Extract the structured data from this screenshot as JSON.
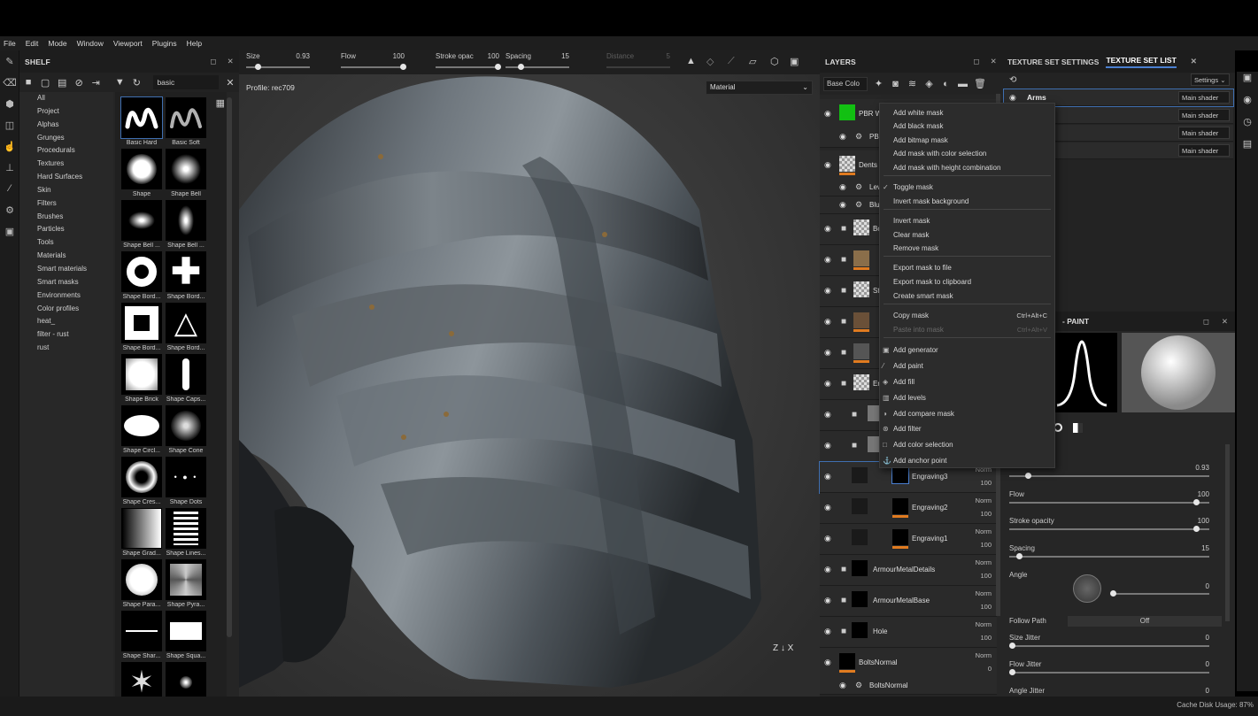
{
  "menu": [
    "File",
    "Edit",
    "Mode",
    "Window",
    "Viewport",
    "Plugins",
    "Help"
  ],
  "shelf": {
    "title": "SHELF",
    "search_value": "basic",
    "categories": [
      "All",
      "Project",
      "Alphas",
      "Grunges",
      "Procedurals",
      "Textures",
      "Hard Surfaces",
      "Skin",
      "Filters",
      "Brushes",
      "Particles",
      "Tools",
      "Materials",
      "Smart materials",
      "Smart masks",
      "Environments",
      "Color profiles",
      "heat_",
      "filter - rust",
      "rust"
    ],
    "items": [
      "Basic Hard",
      "Basic Soft",
      "Shape",
      "Shape Bell",
      "Shape Bell ...",
      "Shape Bell ...",
      "Shape Bord...",
      "Shape Bord...",
      "Shape Bord...",
      "Shape Bord...",
      "Shape Brick",
      "Shape Caps...",
      "Shape Circl...",
      "Shape Cone",
      "Shape Cres...",
      "Shape Dots",
      "Shape Grad...",
      "Shape Lines...",
      "Shape Para...",
      "Shape Pyra...",
      "Shape Shar...",
      "Shape Squa...",
      "",
      ""
    ]
  },
  "viewport": {
    "toolbar": {
      "size_label": "Size",
      "size_value": "0.93",
      "flow_label": "Flow",
      "flow_value": "100",
      "stroke_label": "Stroke opac",
      "stroke_value": "100",
      "spacing_label": "Spacing",
      "spacing_value": "15",
      "distance_label": "Distance",
      "distance_value": "5"
    },
    "profile": "Profile: rec709",
    "material_mode": "Material"
  },
  "layers": {
    "title": "LAYERS",
    "channel": "Base Colo",
    "rows": [
      {
        "name": "PBR W",
        "blend": "",
        "opacity": ""
      },
      {
        "name": "PBR",
        "blend": "",
        "opacity": ""
      },
      {
        "name": "Dents",
        "blend": "",
        "opacity": ""
      },
      {
        "name": "Lev",
        "blend": "",
        "opacity": ""
      },
      {
        "name": "Blu",
        "blend": "",
        "opacity": ""
      },
      {
        "name": "Bo",
        "blend": "",
        "opacity": ""
      },
      {
        "name": "",
        "blend": "",
        "opacity": ""
      },
      {
        "name": "St",
        "blend": "",
        "opacity": ""
      },
      {
        "name": "",
        "blend": "",
        "opacity": ""
      },
      {
        "name": "",
        "blend": "",
        "opacity": ""
      },
      {
        "name": "En",
        "blend": "",
        "opacity": ""
      },
      {
        "name": "",
        "blend": "",
        "opacity": ""
      },
      {
        "name": "",
        "blend": "",
        "opacity": ""
      },
      {
        "name": "Engraving3",
        "blend": "Norm",
        "opacity": "100"
      },
      {
        "name": "Engraving2",
        "blend": "Norm",
        "opacity": "100"
      },
      {
        "name": "Engraving1",
        "blend": "Norm",
        "opacity": "100"
      },
      {
        "name": "ArmourMetalDetails",
        "blend": "Norm",
        "opacity": "100"
      },
      {
        "name": "ArmourMetalBase",
        "blend": "Norm",
        "opacity": "100"
      },
      {
        "name": "Hole",
        "blend": "Norm",
        "opacity": "100"
      },
      {
        "name": "BoltsNormal",
        "blend": "Norm",
        "opacity": "0"
      },
      {
        "name": "BoltsNormal",
        "blend": "",
        "opacity": ""
      }
    ]
  },
  "texture_sets": {
    "tab_settings": "TEXTURE SET SETTINGS",
    "tab_list": "TEXTURE SET LIST",
    "settings_btn": "Settings",
    "rows": [
      {
        "name": "Arms",
        "shader": "Main shader"
      },
      {
        "name": "",
        "shader": "Main shader"
      },
      {
        "name": "",
        "shader": "Main shader"
      },
      {
        "name": "",
        "shader": "Main shader"
      }
    ]
  },
  "properties": {
    "title": "- PAINT",
    "size_value": "0.93",
    "flow_label": "Flow",
    "flow_value": "100",
    "stroke_label": "Stroke opacity",
    "stroke_value": "100",
    "spacing_label": "Spacing",
    "spacing_value": "15",
    "angle_label": "Angle",
    "angle_value": "0",
    "follow_path_label": "Follow Path",
    "follow_path_value": "Off",
    "size_jitter_label": "Size Jitter",
    "size_jitter_value": "0",
    "flow_jitter_label": "Flow Jitter",
    "flow_jitter_value": "0",
    "angle_jitter_label": "Angle Jitter",
    "angle_jitter_value": "0"
  },
  "context_menu": {
    "items": [
      {
        "label": "Add white mask",
        "shortcut": "",
        "disabled": false,
        "icon": ""
      },
      {
        "label": "Add black mask",
        "shortcut": "",
        "disabled": false,
        "icon": ""
      },
      {
        "label": "Add bitmap mask",
        "shortcut": "",
        "disabled": false,
        "icon": ""
      },
      {
        "label": "Add mask with color selection",
        "shortcut": "",
        "disabled": false,
        "icon": ""
      },
      {
        "label": "Add mask with height combination",
        "shortcut": "",
        "disabled": false,
        "icon": ""
      },
      {
        "label": "Toggle mask",
        "shortcut": "",
        "disabled": false,
        "icon": "check-icon"
      },
      {
        "label": "Invert mask background",
        "shortcut": "",
        "disabled": false,
        "icon": ""
      },
      {
        "label": "Invert mask",
        "shortcut": "",
        "disabled": false,
        "icon": ""
      },
      {
        "label": "Clear mask",
        "shortcut": "",
        "disabled": false,
        "icon": ""
      },
      {
        "label": "Remove mask",
        "shortcut": "",
        "disabled": false,
        "icon": ""
      },
      {
        "label": "Export mask to file",
        "shortcut": "",
        "disabled": false,
        "icon": ""
      },
      {
        "label": "Export mask to clipboard",
        "shortcut": "",
        "disabled": false,
        "icon": ""
      },
      {
        "label": "Create smart mask",
        "shortcut": "",
        "disabled": false,
        "icon": ""
      },
      {
        "label": "Copy mask",
        "shortcut": "Ctrl+Alt+C",
        "disabled": false,
        "icon": ""
      },
      {
        "label": "Paste into mask",
        "shortcut": "Ctrl+Alt+V",
        "disabled": true,
        "icon": ""
      },
      {
        "label": "Add generator",
        "shortcut": "",
        "disabled": false,
        "icon": "generator-icon"
      },
      {
        "label": "Add paint",
        "shortcut": "",
        "disabled": false,
        "icon": "brush-icon"
      },
      {
        "label": "Add fill",
        "shortcut": "",
        "disabled": false,
        "icon": "fill-icon"
      },
      {
        "label": "Add levels",
        "shortcut": "",
        "disabled": false,
        "icon": "levels-icon"
      },
      {
        "label": "Add compare mask",
        "shortcut": "",
        "disabled": false,
        "icon": "compare-icon"
      },
      {
        "label": "Add filter",
        "shortcut": "",
        "disabled": false,
        "icon": "filter-icon"
      },
      {
        "label": "Add color selection",
        "shortcut": "",
        "disabled": false,
        "icon": "selection-icon"
      },
      {
        "label": "Add anchor point",
        "shortcut": "",
        "disabled": false,
        "icon": "anchor-icon"
      }
    ]
  },
  "status": {
    "text": "Cache Disk Usage:   87%"
  },
  "colors": {
    "accent": "#4a7fd0",
    "orange": "#e07b20",
    "green": "#12c012"
  }
}
